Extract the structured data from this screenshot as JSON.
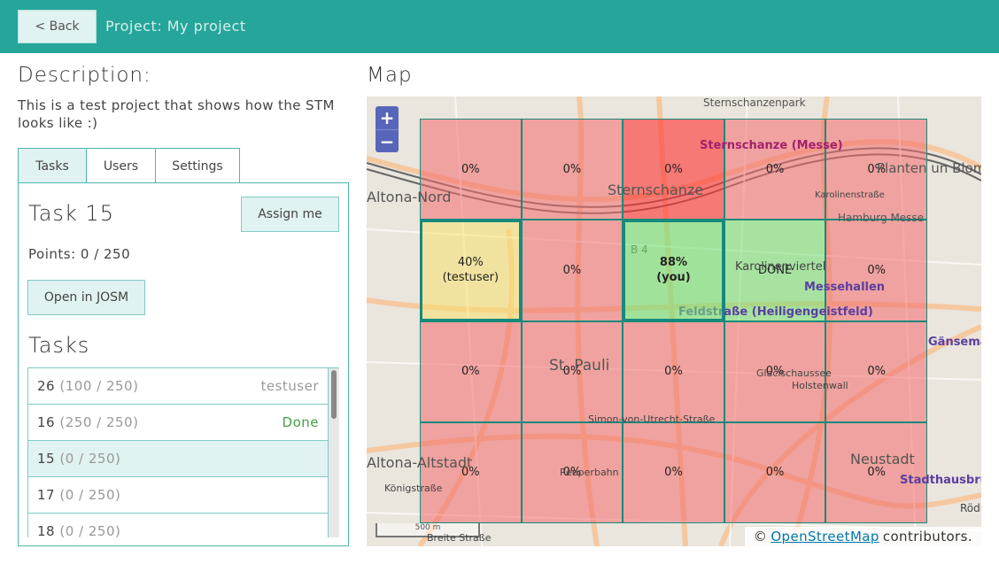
{
  "toolbar": {
    "back_label": "< Back",
    "project_title": "Project: My project"
  },
  "description": {
    "heading": "Description:",
    "text": "This is a test project that shows how the STM looks like :)"
  },
  "tabs": [
    {
      "label": "Tasks",
      "active": true
    },
    {
      "label": "Users",
      "active": false
    },
    {
      "label": "Settings",
      "active": false
    }
  ],
  "task": {
    "title": "Task 15",
    "assign_label": "Assign me",
    "points": "Points: 0 / 250",
    "josm_label": "Open in JOSM"
  },
  "tasks_heading": "Tasks",
  "task_list": [
    {
      "id": "26",
      "points": "(100 / 250)",
      "status": "testuser",
      "done": false,
      "selected": false
    },
    {
      "id": "16",
      "points": "(250 / 250)",
      "status": "Done",
      "done": true,
      "selected": false
    },
    {
      "id": "15",
      "points": "(0 / 250)",
      "status": "",
      "done": false,
      "selected": true
    },
    {
      "id": "17",
      "points": "(0 / 250)",
      "status": "",
      "done": false,
      "selected": false
    },
    {
      "id": "18",
      "points": "(0 / 250)",
      "status": "",
      "done": false,
      "selected": false
    }
  ],
  "map": {
    "heading": "Map",
    "zoom_in": "+",
    "zoom_out": "−",
    "scale_label": "500 m",
    "attribution_prefix": "©",
    "attribution_link": "OpenStreetMap",
    "attribution_suffix": "contributors.",
    "place_labels": [
      "Sternschanzenpark",
      "Sternschanze (Messe)",
      "Sternschanze",
      "Altona-Nord",
      "Planten un Blomen",
      "Hamburg Messe",
      "Karolinenviertel",
      "Messehallen",
      "Feldstraße (Heiligengeistfeld)",
      "St. Pauli",
      "Simon-von-Utrecht-Straße",
      "Reeperbahn",
      "Altona-Altstadt",
      "Neustadt",
      "Stadthausbrü",
      "Gänsema (Oper)",
      "Königstraße",
      "Breite Straße",
      "Holstenwall",
      "Glacischaussee",
      "Karolinenstraße",
      "Rödings",
      "B 4"
    ],
    "grid_cells": [
      [
        "0%",
        "0%",
        "0%",
        "0%",
        "0%"
      ],
      [
        "40%\n(testuser)",
        "0%",
        "88%\n(you)",
        "DONE",
        "0%"
      ],
      [
        "0%",
        "0%",
        "0%",
        "0%",
        "0%"
      ],
      [
        "0%",
        "0%",
        "0%",
        "0%",
        "0%"
      ]
    ],
    "colors": {
      "task_open": "#f26b6b",
      "task_done": "#6fe06f",
      "task_partial": "#f5e26b",
      "grid_border": "#168a7c",
      "accent": "#26a69a"
    }
  }
}
